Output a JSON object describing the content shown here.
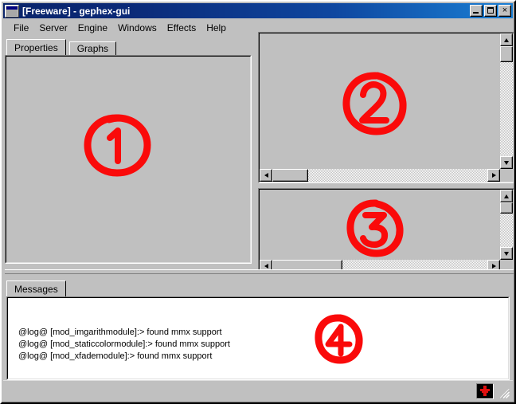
{
  "window": {
    "title": "[Freeware] - gephex-gui",
    "icon": "window-icon",
    "buttons": {
      "minimize": "_",
      "maximize": "[]",
      "close": "×"
    }
  },
  "menubar": {
    "items": [
      {
        "label": "File"
      },
      {
        "label": "Server"
      },
      {
        "label": "Engine"
      },
      {
        "label": "Windows"
      },
      {
        "label": "Effects"
      },
      {
        "label": "Help"
      }
    ]
  },
  "left_panel": {
    "tabs": [
      {
        "label": "Properties",
        "active": true
      },
      {
        "label": "Graphs",
        "active": false
      }
    ],
    "annotation": "1"
  },
  "panel_two": {
    "annotation": "2",
    "scroll": {
      "vertical_thumb_pos": "top",
      "horizontal_thumb_pos": "left"
    }
  },
  "panel_three": {
    "annotation": "3",
    "scroll": {
      "vertical_thumb_pos": "top",
      "horizontal_thumb_pos": "left"
    }
  },
  "messages_panel": {
    "tabs": [
      {
        "label": "Messages",
        "active": true
      }
    ],
    "annotation": "4",
    "log_lines": [
      "@log@ [mod_imgarithmodule]:> found mmx support",
      "@log@ [mod_staticcolormodule]:> found mmx support",
      "@log@ [mod_xfademodule]:> found mmx support"
    ]
  },
  "statusbar": {
    "indicator_icon": "red-cross-icon",
    "resize_grip_icon": "resize-grip-icon"
  },
  "colors": {
    "face": "#c0c0c0",
    "title_start": "#0a246a",
    "title_end": "#1a7fd4",
    "annotation_red": "#fa0a0a",
    "text": "#000000",
    "window_white": "#ffffff"
  }
}
